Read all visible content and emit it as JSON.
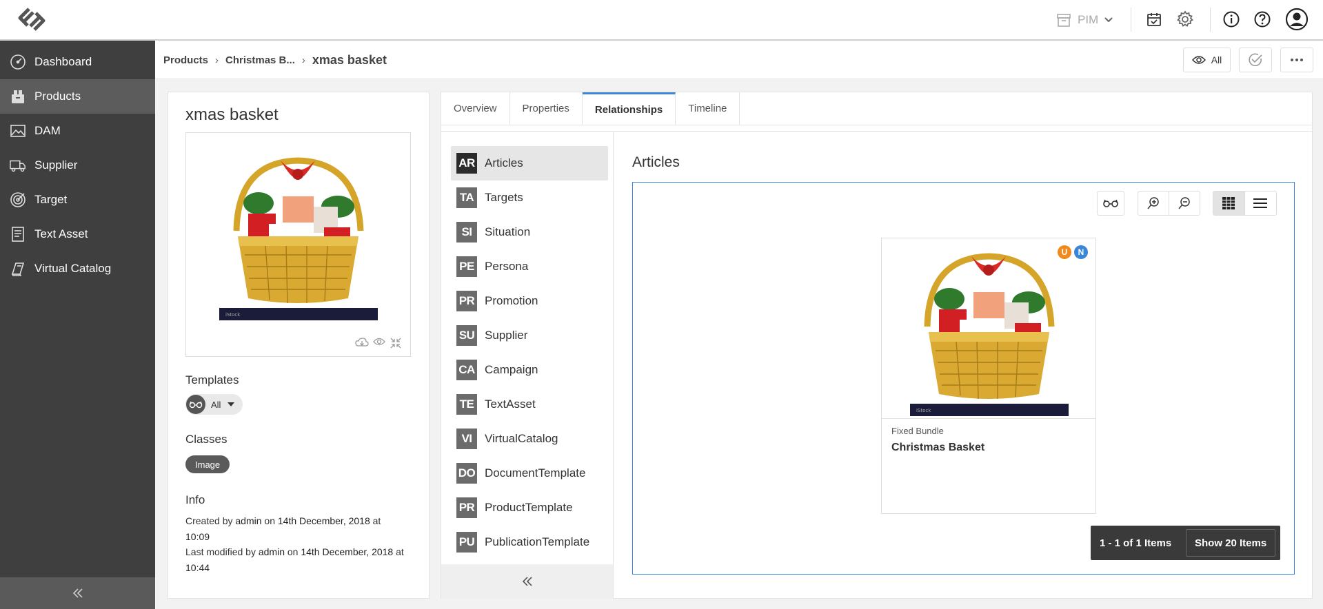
{
  "topbar": {
    "module_label": "PIM",
    "icons": [
      "logo-icon",
      "archive-icon",
      "chevron-down-icon",
      "calendar-check-icon",
      "gear-icon",
      "info-icon",
      "help-icon",
      "user-avatar-icon"
    ]
  },
  "sidebar": {
    "items": [
      {
        "label": "Dashboard",
        "icon": "speedometer-icon"
      },
      {
        "label": "Products",
        "icon": "box-icon"
      },
      {
        "label": "DAM",
        "icon": "image-icon"
      },
      {
        "label": "Supplier",
        "icon": "truck-icon"
      },
      {
        "label": "Target",
        "icon": "target-icon"
      },
      {
        "label": "Text Asset",
        "icon": "document-icon"
      },
      {
        "label": "Virtual Catalog",
        "icon": "book-icon"
      }
    ],
    "active": "Products"
  },
  "breadcrumb": {
    "items": [
      "Products",
      "Christmas B...",
      "xmas basket"
    ]
  },
  "header_actions": {
    "view_label": "All"
  },
  "product": {
    "title": "xmas basket",
    "templates_label": "Templates",
    "template_value": "All",
    "classes_label": "Classes",
    "class_badge": "Image",
    "info_label": "Info",
    "created_prefix": "Created by",
    "created_user": "admin",
    "created_on": "on",
    "created_date": "14th December, 2018",
    "created_at": "at",
    "created_time": "10:09",
    "modified_prefix": "Last modified by",
    "modified_user": "admin",
    "modified_on": "on",
    "modified_date": "14th December, 2018",
    "modified_at": "at",
    "modified_time": "10:44"
  },
  "tabs": [
    {
      "label": "Overview"
    },
    {
      "label": "Properties"
    },
    {
      "label": "Relationships"
    },
    {
      "label": "Timeline"
    }
  ],
  "active_tab": "Relationships",
  "relationships": [
    {
      "code": "AR",
      "label": "Articles"
    },
    {
      "code": "TA",
      "label": "Targets"
    },
    {
      "code": "SI",
      "label": "Situation"
    },
    {
      "code": "PE",
      "label": "Persona"
    },
    {
      "code": "PR",
      "label": "Promotion"
    },
    {
      "code": "SU",
      "label": "Supplier"
    },
    {
      "code": "CA",
      "label": "Campaign"
    },
    {
      "code": "TE",
      "label": "TextAsset"
    },
    {
      "code": "VI",
      "label": "VirtualCatalog"
    },
    {
      "code": "DO",
      "label": "DocumentTemplate"
    },
    {
      "code": "PR",
      "label": "ProductTemplate"
    },
    {
      "code": "PU",
      "label": "PublicationTemplate"
    }
  ],
  "active_relationship": "Articles",
  "panel": {
    "title": "Articles",
    "card": {
      "type": "Fixed Bundle",
      "name": "Christmas Basket",
      "badges": [
        {
          "text": "U",
          "color": "#f08a1c"
        },
        {
          "text": "N",
          "color": "#3b86d6"
        }
      ]
    },
    "pager": {
      "range": "1 - 1 of 1 Items",
      "show": "Show 20 Items"
    }
  },
  "colors": {
    "sidebar_bg": "#3f3f3f",
    "sidebar_active": "#5c5c5c",
    "accent": "#3b86d6"
  }
}
